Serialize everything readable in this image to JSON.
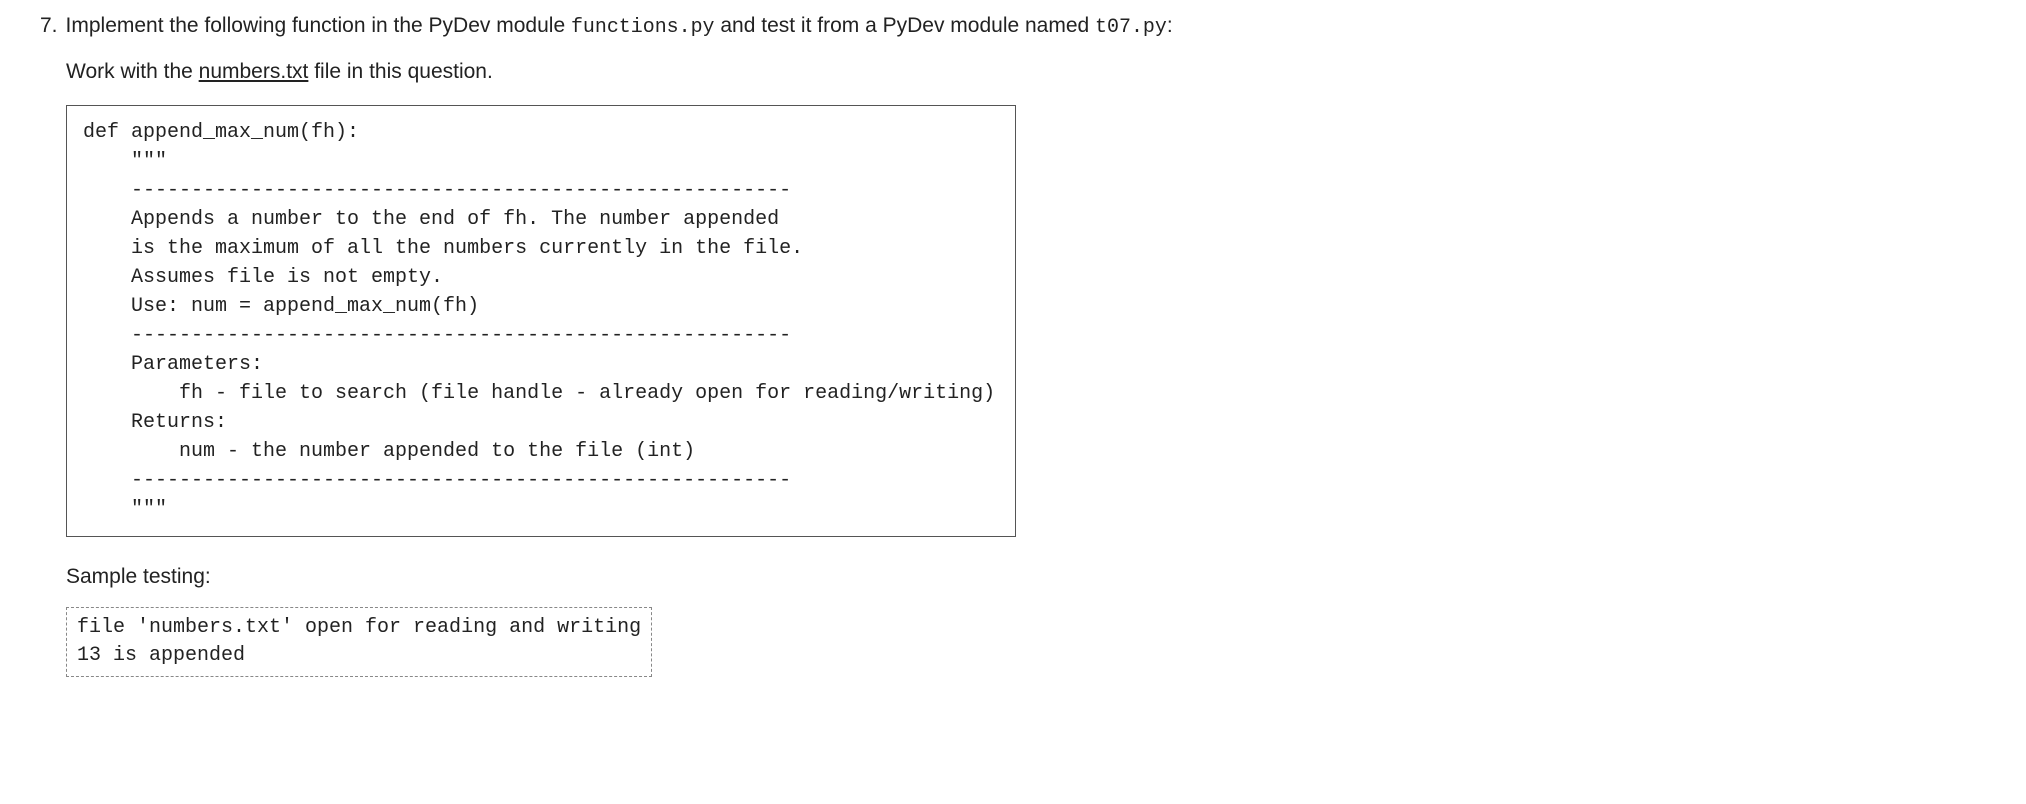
{
  "question": {
    "number": "7.",
    "intro_pre": "Implement the following function in the PyDev module ",
    "intro_code1": "functions.py",
    "intro_mid": " and test it from a PyDev module named ",
    "intro_code2": "t07.py",
    "intro_post": ":",
    "work_pre": "Work with the ",
    "work_link": "numbers.txt",
    "work_post": " file in this question."
  },
  "code_block": "def append_max_num(fh):\n    \"\"\"\n    -------------------------------------------------------\n    Appends a number to the end of fh. The number appended\n    is the maximum of all the numbers currently in the file.\n    Assumes file is not empty.\n    Use: num = append_max_num(fh)\n    -------------------------------------------------------\n    Parameters:\n        fh - file to search (file handle - already open for reading/writing)\n    Returns:\n        num - the number appended to the file (int)\n    -------------------------------------------------------\n    \"\"\"",
  "sample": {
    "label": "Sample testing:",
    "output": "file 'numbers.txt' open for reading and writing\n13 is appended"
  }
}
